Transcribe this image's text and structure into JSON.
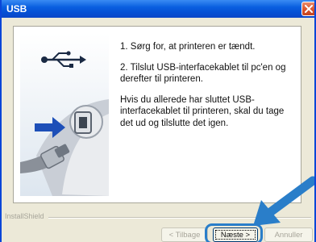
{
  "window": {
    "title": "USB",
    "close_icon": "close-icon"
  },
  "graphic": {
    "usb_icon": "usb-icon",
    "cable_art": "usb-cable-computer-icon"
  },
  "instructions": [
    "1. Sørg for, at printeren er tændt.",
    "2. Tilslut USB-interfacekablet til pc'en og derefter til printeren.",
    "Hvis du allerede har sluttet USB-interfacekablet til printeren, skal du tage det ud og tilslutte det igen."
  ],
  "footer": {
    "brand": "InstallShield"
  },
  "buttons": {
    "back": "< Tilbage",
    "next": "Næste >",
    "cancel": "Annuller"
  },
  "colors": {
    "highlight": "#2a7ec9",
    "title_bar": "#0a5fe0"
  }
}
